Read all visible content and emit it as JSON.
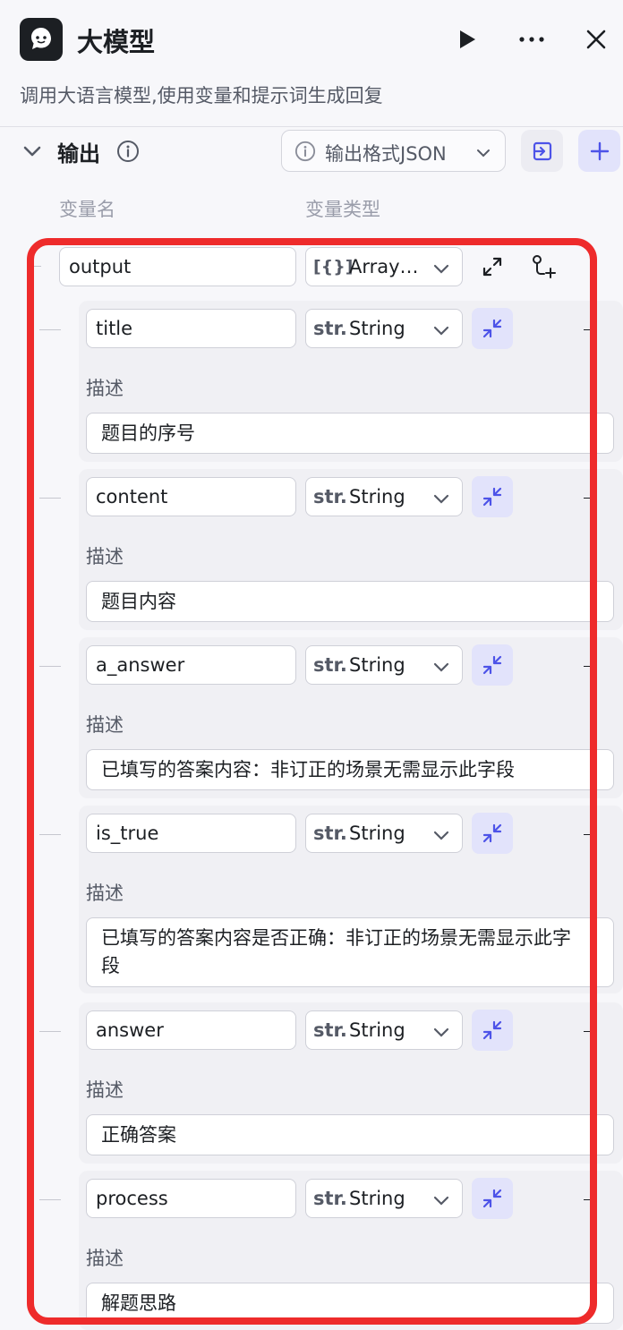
{
  "header": {
    "title": "大模型",
    "subtitle": "调用大语言模型,使用变量和提示词生成回复"
  },
  "output_section": {
    "title": "输出",
    "format_label": "输出格式JSON",
    "col_name": "变量名",
    "col_type": "变量类型"
  },
  "root_field": {
    "name": "output",
    "type_icon": "[{}]",
    "type_label": "Array…"
  },
  "children": [
    {
      "name": "title",
      "type_icon": "str.",
      "type_label": "String",
      "desc_label": "描述",
      "description": "题目的序号"
    },
    {
      "name": "content",
      "type_icon": "str.",
      "type_label": "String",
      "desc_label": "描述",
      "description": "题目内容"
    },
    {
      "name": "a_answer",
      "type_icon": "str.",
      "type_label": "String",
      "desc_label": "描述",
      "description": "已填写的答案内容：非订正的场景无需显示此字段"
    },
    {
      "name": "is_true",
      "type_icon": "str.",
      "type_label": "String",
      "desc_label": "描述",
      "description": "已填写的答案内容是否正确：非订正的场景无需显示此字段"
    },
    {
      "name": "answer",
      "type_icon": "str.",
      "type_label": "String",
      "desc_label": "描述",
      "description": "正确答案"
    },
    {
      "name": "process",
      "type_icon": "str.",
      "type_label": "String",
      "desc_label": "描述",
      "description": "解题思路"
    }
  ],
  "colors": {
    "accent": "#4d53e8",
    "highlight_frame": "#ee2b2b"
  }
}
